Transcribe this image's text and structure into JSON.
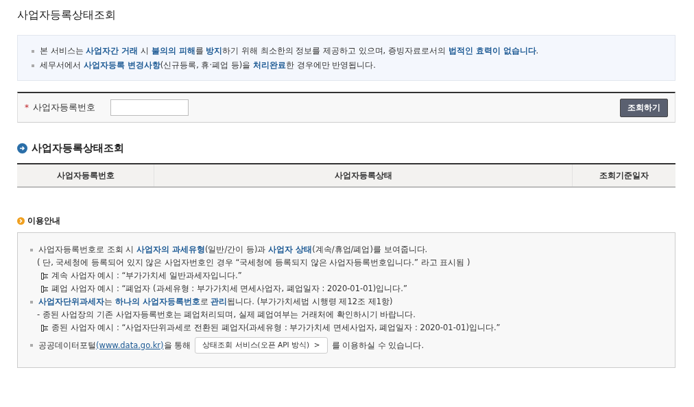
{
  "page_title": "사업자등록상태조회",
  "notices": [
    "본 서비스는 **사업자간 거래** 시 **불의의 피해**를 **방지**하기 위해 최소한의 정보를 제공하고 있으며, 증빙자료로서의 **법적인 효력이 없습니다**.",
    "세무서에서 **사업자등록 변경사항**(신규등록, 휴·폐업 등)을 **처리완료**한 경우에만 반영됩니다."
  ],
  "search": {
    "required_mark": "*",
    "label": "사업자등록번호",
    "button": "조회하기"
  },
  "result": {
    "title": "사업자등록상태조회",
    "columns": [
      "사업자등록번호",
      "사업자등록상태",
      "조회기준일자"
    ]
  },
  "guide": {
    "title": "이용안내",
    "lines": [
      {
        "kind": "bullet",
        "text": "사업자등록번호로 조회 시 **사업자의 과세유형**(일반/간이 등)과 **사업자 상태**(계속/휴업/폐업)를 보여줍니다."
      },
      {
        "kind": "note",
        "text": "( 단, 국세청에 등록되어 있지 않은 사업자번호인 경우 “국세청에 등록되지 않은 사업자등록번호입니다.” 라고 표시됨 )"
      },
      {
        "kind": "example",
        "text": "계속 사업자 예시 : “부가가치세 일반과세자입니다.”"
      },
      {
        "kind": "example",
        "text": "폐업 사업자 예시 : “폐업자 (과세유형 : 부가가치세 면세사업자, 폐업일자 : 2020-01-01)입니다.”"
      },
      {
        "kind": "bullet",
        "text": "**사업자단위과세자**는 **하나의 사업자등록번호**로 **관리**됩니다. (부가가치세법 시행령 제12조 제1항)"
      },
      {
        "kind": "note",
        "text": "- 종된 사업장의 기존 사업자등록번호는 폐업처리되며, 실제 폐업여부는 거래처에 확인하시기 바랍니다."
      },
      {
        "kind": "example",
        "text": "종된 사업자 예시 : “사업자단위과세로 전환된 폐업자(과세유형 : 부가가치세 면세사업자, 폐업일자 : 2020-01-01)입니다.”"
      },
      {
        "kind": "portal",
        "before": "공공데이터포털",
        "link": "(www.data.go.kr)",
        "middle": "을 통해",
        "button": "상태조회 서비스(오픈 API 방식)",
        "button_arrow": ">",
        "after": "를 이용하실 수 있습니다."
      }
    ]
  }
}
